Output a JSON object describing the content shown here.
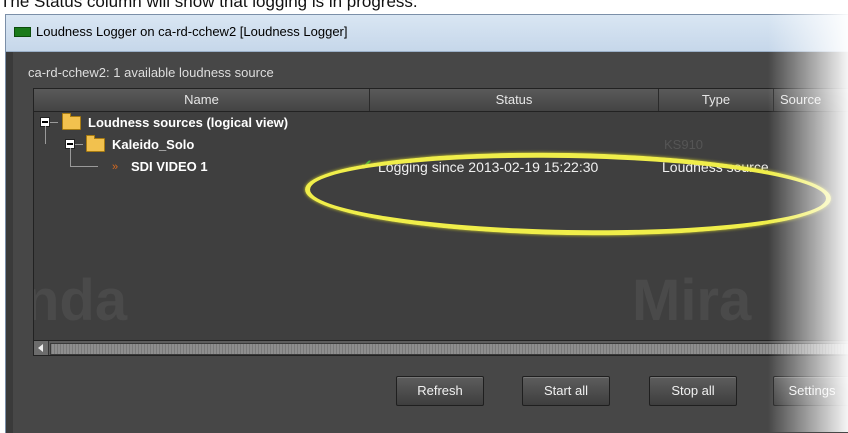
{
  "caption": "The Status column will show that logging is in progress.",
  "window": {
    "title": "Loudness Logger on ca-rd-cchew2 [Loudness Logger]",
    "source_count": "ca-rd-cchew2: 1 available loudness source"
  },
  "table": {
    "columns": [
      "Name",
      "Status",
      "Type",
      "Source"
    ],
    "rows": [
      {
        "label": "Loudness sources (logical view)",
        "status": "",
        "type": ""
      },
      {
        "label": "Kaleido_Solo",
        "status": "",
        "type": "KS910"
      },
      {
        "label": "SDI VIDEO 1",
        "status": "Logging since 2013-02-19 15:22:30",
        "type": "Loudness source"
      }
    ]
  },
  "watermark": {
    "left": "nda",
    "right": "Mira"
  },
  "buttons": {
    "refresh": "Refresh",
    "start_all": "Start all",
    "stop_all": "Stop all",
    "settings": "Settings"
  },
  "colors": {
    "window_bg": "#474747",
    "highlight": "#f0ee4a",
    "status_ok": "#3fb83f"
  }
}
